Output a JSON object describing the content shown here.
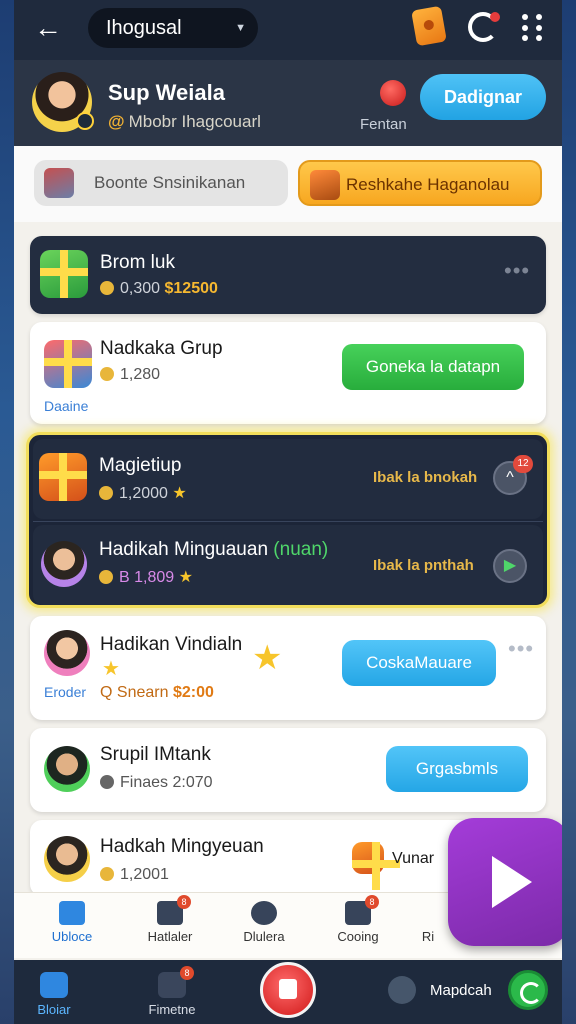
{
  "header": {
    "search_value": "Ihogusal",
    "profile_name": "Sup Weiala",
    "profile_sub_symbol": "@",
    "profile_sub": "Mbobr Ihagcouarl",
    "heart_label": "Fentan",
    "primary_button": "Dadignar"
  },
  "actions": {
    "grey": "Boonte Snsinikanan",
    "orange": "Reshkahe Haganolau"
  },
  "cards": {
    "c1": {
      "title": "Brom luk",
      "amount": "0,300",
      "gold": "$12500"
    },
    "c2": {
      "title": "Nadkaka Grup",
      "amount": "1,280",
      "tag": "Daaine",
      "button": "Goneka la datapn"
    },
    "c3": {
      "title": "Magietiup",
      "amount": "1,2000",
      "tag": "Ibak la bnokah",
      "badge": "12"
    },
    "c4": {
      "title": "Hadikah Minguauan",
      "title_extra": "(nuan)",
      "amount": "B 1,809",
      "tag": "Ibak la pnthah"
    },
    "c5": {
      "title": "Hadikan Vindialn",
      "amount_prefix": "Q",
      "amount_text": "Snearn",
      "gold": "$2:00",
      "tag": "Eroder",
      "button": "CoskaMauare"
    },
    "c6": {
      "title": "Srupil IMtank",
      "amount": "Finaes 2:070",
      "button": "Grgasbmls"
    },
    "c7": {
      "title": "Hadkah Mingyeuan",
      "amount": "1,2001",
      "side": "Vunar"
    }
  },
  "tabs": [
    {
      "label": "Ubloce",
      "icon": "home-icon",
      "active": true
    },
    {
      "label": "Hatlaler",
      "icon": "camera-icon",
      "badge": "8"
    },
    {
      "label": "Dlulera",
      "icon": "download-icon"
    },
    {
      "label": "Cooing",
      "icon": "inbox-icon",
      "badge": "8"
    },
    {
      "label": "Ri",
      "icon": "profile-icon"
    }
  ],
  "bottom_nav": {
    "home": "Bloiar",
    "second": "Fimetne",
    "second_badge": "8",
    "third": "Mapdcah"
  }
}
